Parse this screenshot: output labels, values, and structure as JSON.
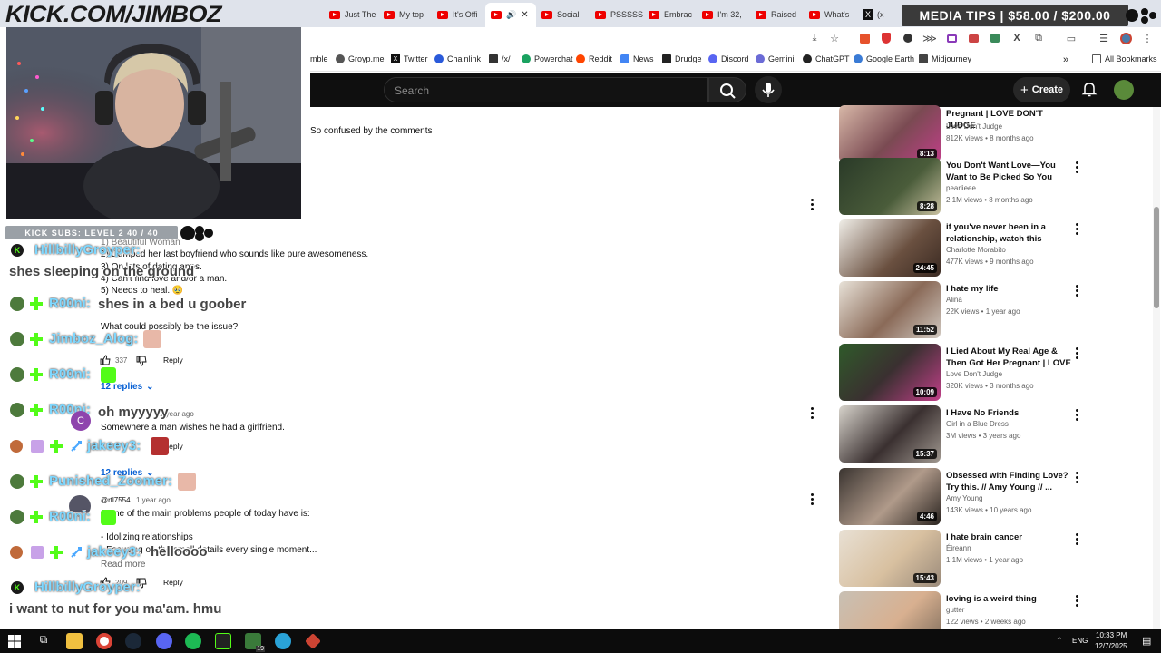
{
  "browser": {
    "tabs": [
      {
        "label": "Just The",
        "icon": "youtube-icon"
      },
      {
        "label": "My top",
        "icon": "youtube-icon"
      },
      {
        "label": "It's Offi",
        "icon": "youtube-icon"
      },
      {
        "label": "",
        "icon": "youtube-icon",
        "active": true
      },
      {
        "label": "Social",
        "icon": "youtube-icon"
      },
      {
        "label": "PSSSSS",
        "icon": "youtube-icon"
      },
      {
        "label": "Embrac",
        "icon": "youtube-icon"
      },
      {
        "label": "I'm 32,",
        "icon": "youtube-icon"
      },
      {
        "label": "Raised",
        "icon": "youtube-icon"
      },
      {
        "label": "What's",
        "icon": "youtube-icon"
      },
      {
        "label": "(x",
        "icon": "x-icon"
      }
    ],
    "bookmarks": [
      {
        "label": "mble",
        "color": "#888888"
      },
      {
        "label": "Groyp.me",
        "color": "#555555"
      },
      {
        "label": "Twitter",
        "color": "#111111"
      },
      {
        "label": "Chainlink",
        "color": "#2a5ada"
      },
      {
        "label": "/x/",
        "color": "#333333"
      },
      {
        "label": "Powerchat",
        "color": "#1aa260"
      },
      {
        "label": "Reddit",
        "color": "#ff4500"
      },
      {
        "label": "News",
        "color": "#4285f4"
      },
      {
        "label": "Drudge",
        "color": "#222222"
      },
      {
        "label": "Discord",
        "color": "#5865f2"
      },
      {
        "label": "Gemini",
        "color": "#6b6bd6"
      },
      {
        "label": "ChatGPT",
        "color": "#222222"
      },
      {
        "label": "Google Earth",
        "color": "#3a7bd5"
      },
      {
        "label": "Midjourney",
        "color": "#444444"
      }
    ],
    "all_bookmarks": "All Bookmarks"
  },
  "overlay": {
    "kick_url": "KICK.COM/JIMBOZ",
    "media_tips": "MEDIA TIPS | $58.00 / $200.00",
    "kick_subs": "KICK SUBS: LEVEL 2 40 / 40"
  },
  "youtube": {
    "search_placeholder": "Search",
    "create_label": "Create"
  },
  "comments": {
    "c0_tail": "So confused by the comments",
    "c1_lines": [
      "1) Beautiful Woman",
      "2) Dumped her last boyfriend who sounds like pure awesomeness.",
      "3) On lots of dating apps.",
      "4) Can't find love and/or a man.",
      "5) Needs to heal. 🥹",
      "What could possibly be the issue?"
    ],
    "c1_likes": "337",
    "c1_replies": "12 replies",
    "c2_time": "1 year ago",
    "c2_text": "Somewhere a man wishes he had a girlfriend.",
    "c2_replies": "12 replies",
    "c3_author": "@rtl7554",
    "c3_time": "1 year ago",
    "c3_line1": "Some of the main problems people of today have is:",
    "c3_line2": "- Idolizing relationships",
    "c3_line3": "- Focusing on the small details every single moment...",
    "c3_readmore": "Read more",
    "c3_likes": "209",
    "reply_label": "Reply"
  },
  "videos": [
    {
      "title": "Pregnant | LOVE DON'T JUDGE",
      "channel": "Love Don't Judge",
      "meta": "812K views • 8 months ago",
      "duration": "8:13"
    },
    {
      "title": "You Don't Want Love—You Want to Be Picked So You Feel ...",
      "channel": "pearlieee",
      "meta": "2.1M views • 8 months ago",
      "duration": "8:28"
    },
    {
      "title": "if you've never been in a relationship, watch this",
      "channel": "Charlotte Morabito",
      "meta": "477K views • 9 months ago",
      "duration": "24:45"
    },
    {
      "title": "I hate my life",
      "channel": "Alina",
      "meta": "22K views • 1 year ago",
      "duration": "11:52"
    },
    {
      "title": "I Lied About My Real Age & Then Got Her Pregnant | LOVE ...",
      "channel": "Love Don't Judge",
      "meta": "320K views • 3 months ago",
      "duration": "10:09"
    },
    {
      "title": "I Have No Friends",
      "channel": "Girl in a Blue Dress",
      "meta": "3M views • 3 years ago",
      "duration": "15:37"
    },
    {
      "title": "Obsessed with Finding Love? Try this. // Amy Young // ...",
      "channel": "Amy Young",
      "meta": "143K views • 10 years ago",
      "duration": "4:46"
    },
    {
      "title": "I hate brain cancer",
      "channel": "Éireann",
      "meta": "1.1M views • 1 year ago",
      "duration": "15:43"
    },
    {
      "title": "loving is a weird thing",
      "channel": "gutter",
      "meta": "122 views • 2 weeks ago",
      "duration": ""
    }
  ],
  "chat": [
    {
      "name": "HillbillyGroyper:",
      "msg": "shes sleeping on the ground"
    },
    {
      "name": "R00ni:",
      "msg": "shes in a bed u goober"
    },
    {
      "name": "Jimboz_Alog:",
      "msg": ""
    },
    {
      "name": "R00ni:",
      "msg": ""
    },
    {
      "name": "R00ni:",
      "msg": "oh myyyyy"
    },
    {
      "name": "jakeey3:",
      "msg": ""
    },
    {
      "name": "Punished_Zoomer:",
      "msg": ""
    },
    {
      "name": "R00ni:",
      "msg": ""
    },
    {
      "name": "jakeey3:",
      "msg": "helloooo"
    },
    {
      "name": "HillbillyGroyper:",
      "msg": "i want to nut for you ma'am. hmu"
    }
  ],
  "taskbar": {
    "lang": "ENG",
    "time": "10:33 PM",
    "date": "12/7/2025",
    "badge": "19"
  },
  "colors": {
    "yt_dark": "#0f0f0f",
    "chat_name": "#7fd8ff",
    "kick_green": "#53fc18"
  }
}
